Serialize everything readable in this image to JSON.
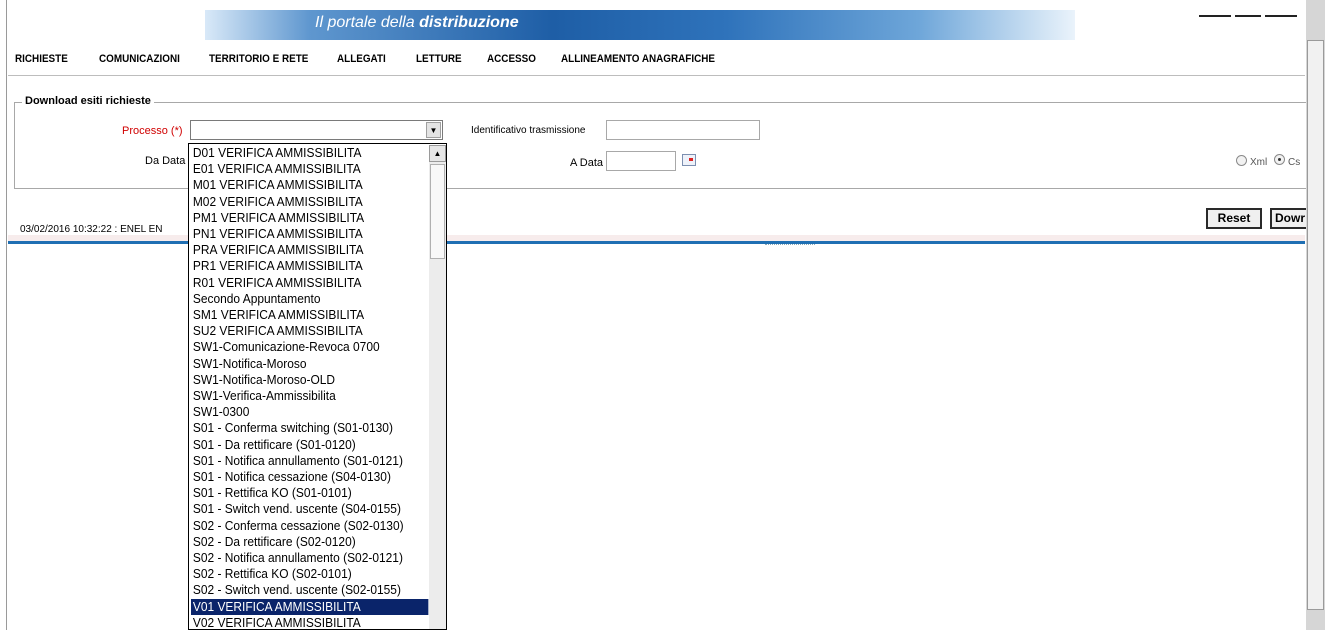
{
  "banner": {
    "title_prefix": "Il portale della ",
    "title_bold": "distribuzione"
  },
  "nav": {
    "items": [
      "RICHIESTE",
      "COMUNICAZIONI",
      "TERRITORIO E RETE",
      "ALLEGATI",
      "LETTURE",
      "ACCESSO",
      "ALLINEAMENTO ANAGRAFICHE"
    ]
  },
  "form": {
    "legend": "Download esiti richieste",
    "processo_label": "Processo (*)",
    "identificativo_label": "Identificativo trasmissione",
    "da_data_label": "Da Data",
    "a_data_label": "A Data",
    "format_xml": "Xml",
    "format_csv": "Cs"
  },
  "status": {
    "text": "03/02/2016 10:32:22  :  ENEL EN"
  },
  "buttons": {
    "reset": "Reset",
    "download": "Dowr"
  },
  "dropdown": {
    "items": [
      "D01 VERIFICA AMMISSIBILITA",
      "E01 VERIFICA AMMISSIBILITA",
      "M01 VERIFICA AMMISSIBILITA",
      "M02 VERIFICA AMMISSIBILITA",
      "PM1 VERIFICA AMMISSIBILITA",
      "PN1 VERIFICA AMMISSIBILITA",
      "PRA VERIFICA AMMISSIBILITA",
      "PR1 VERIFICA AMMISSIBILITA",
      "R01 VERIFICA AMMISSIBILITA",
      "Secondo Appuntamento",
      "SM1 VERIFICA AMMISSIBILITA",
      "SU2 VERIFICA AMMISSIBILITA",
      "SW1-Comunicazione-Revoca 0700",
      "SW1-Notifica-Moroso",
      "SW1-Notifica-Moroso-OLD",
      "SW1-Verifica-Ammissibilita",
      "SW1-0300",
      "S01 - Conferma switching (S01-0130)",
      "S01 - Da rettificare (S01-0120)",
      "S01 - Notifica annullamento (S01-0121)",
      "S01 - Notifica cessazione (S04-0130)",
      "S01 - Rettifica KO (S01-0101)",
      "S01 - Switch vend. uscente (S04-0155)",
      "S02 - Conferma cessazione (S02-0130)",
      "S02 - Da rettificare (S02-0120)",
      "S02 - Notifica annullamento (S02-0121)",
      "S02 - Rettifica KO (S02-0101)",
      "S02 - Switch vend. uscente (S02-0155)",
      "V01 VERIFICA AMMISSIBILITA",
      "V02 VERIFICA AMMISSIBILITA"
    ],
    "selected_index": 28
  },
  "icons": {
    "calendar": "calendar-icon",
    "select_arrow": "chevron-down-icon",
    "scroll_up": "chevron-up-icon"
  }
}
